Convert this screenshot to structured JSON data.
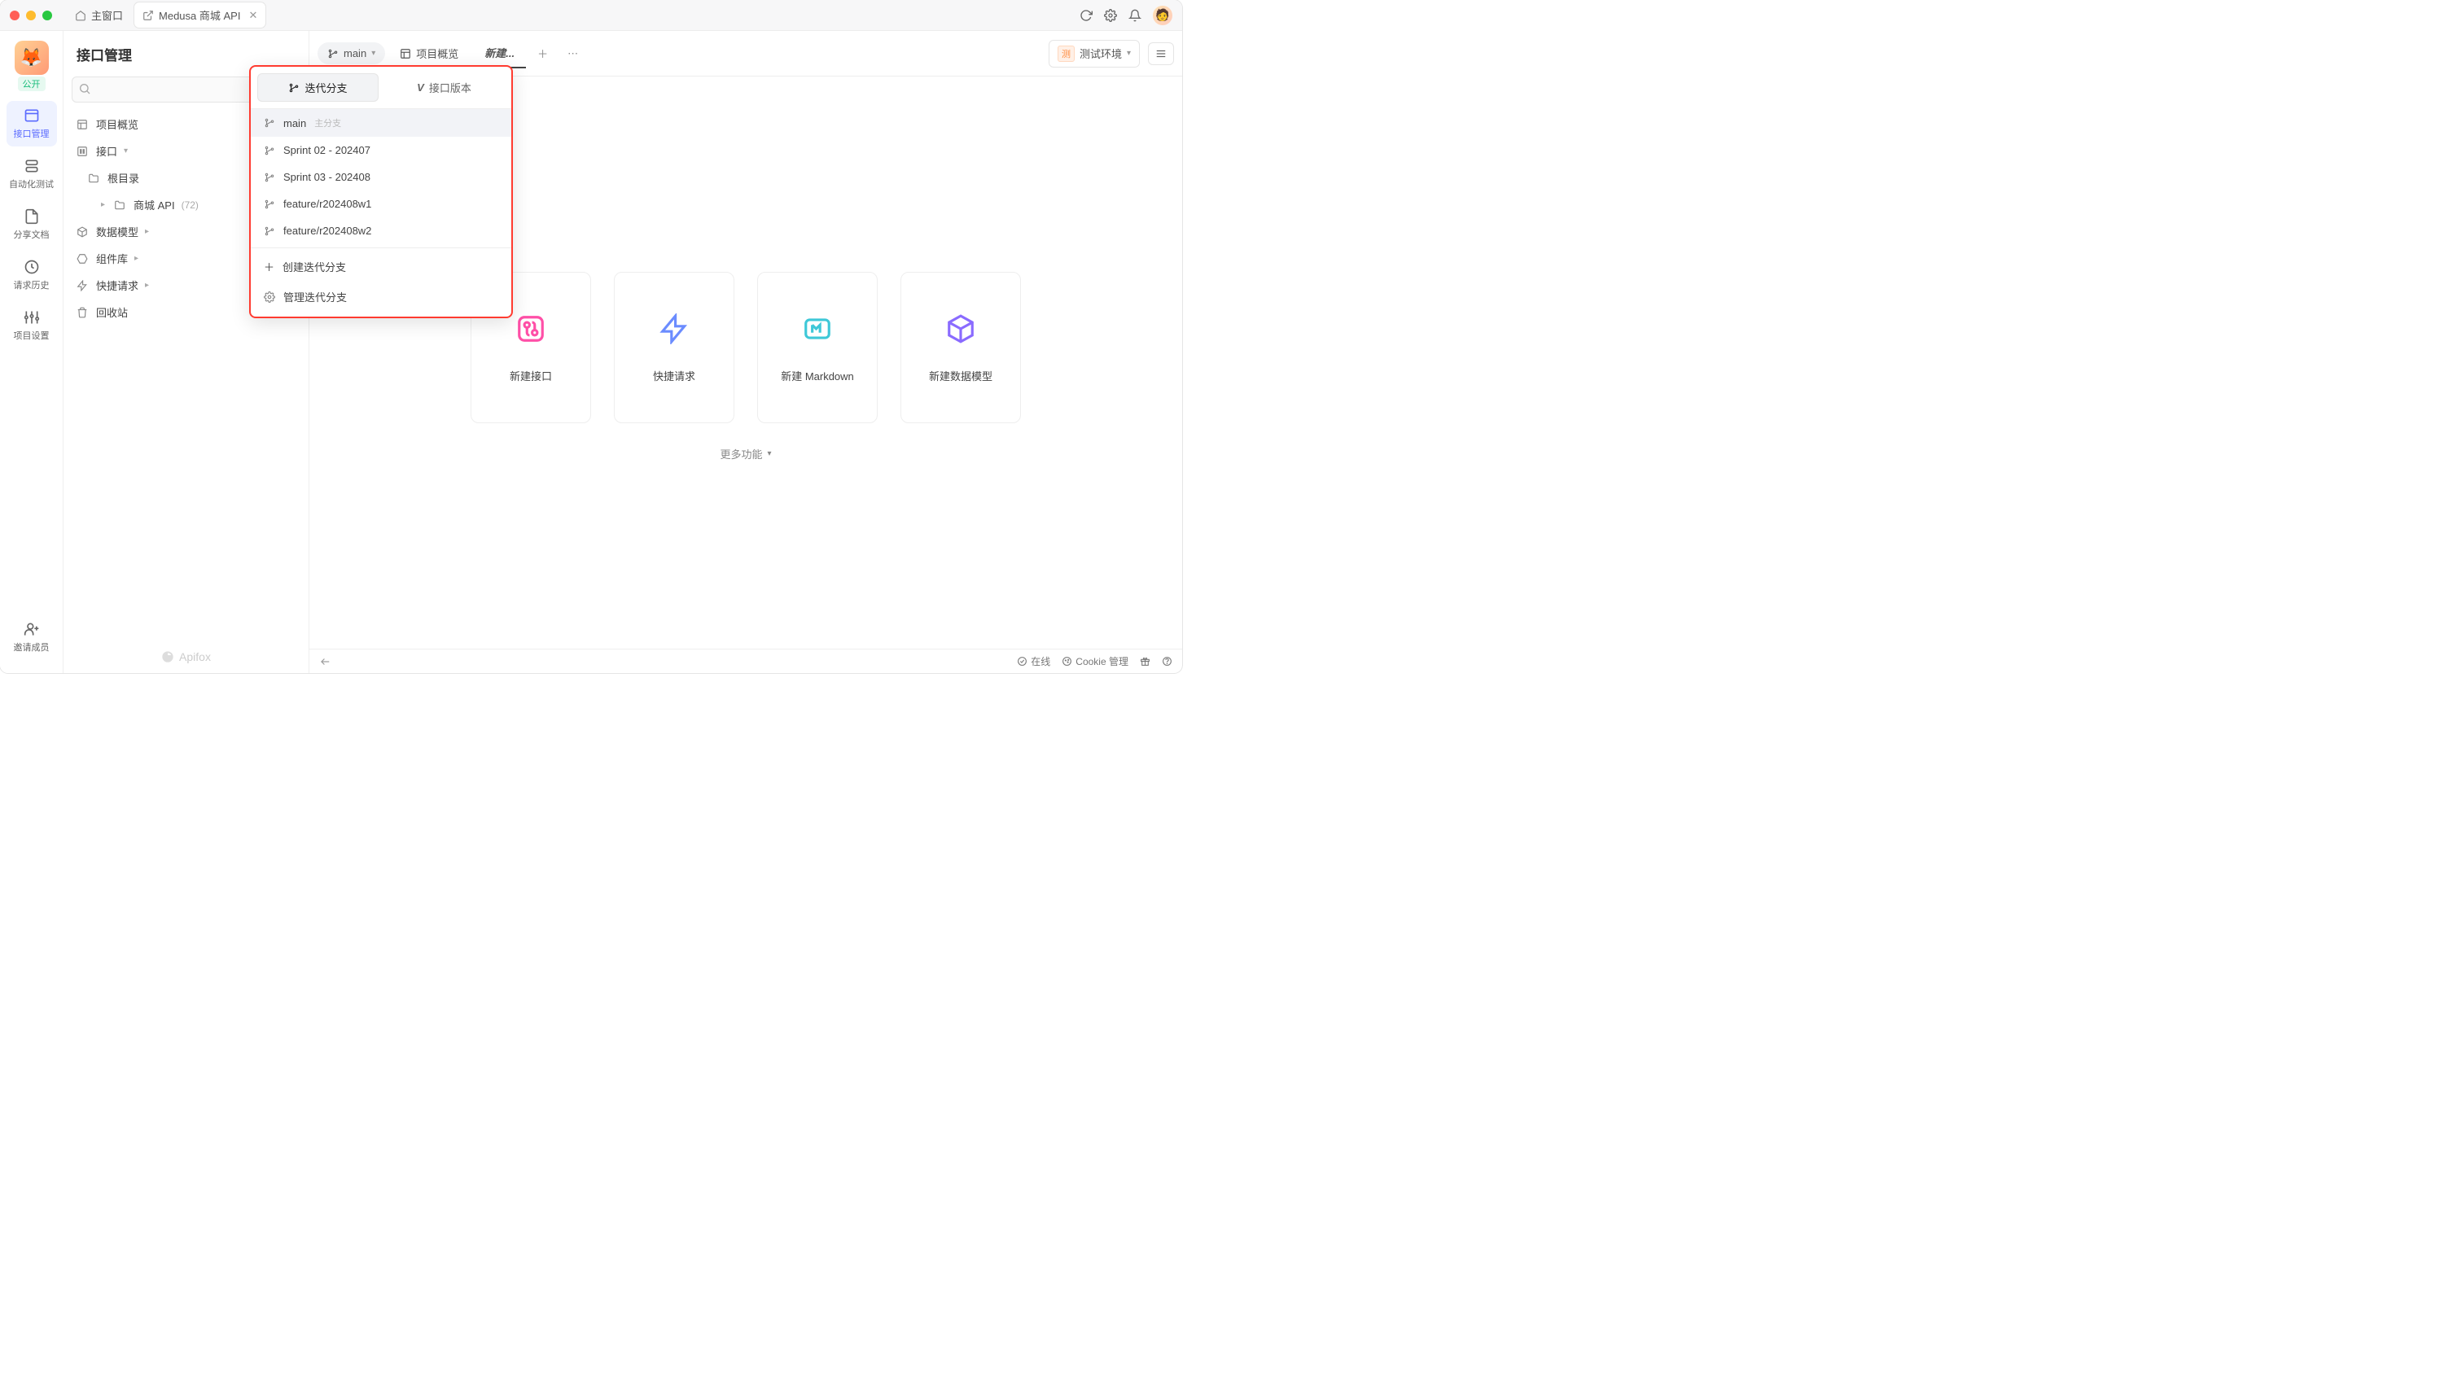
{
  "titlebar": {
    "main_window": "主窗口",
    "active_tab": "Medusa 商城 API"
  },
  "leftrail": {
    "project_badge": "公开",
    "items": [
      {
        "label": "接口管理",
        "active": true
      },
      {
        "label": "自动化测试"
      },
      {
        "label": "分享文档"
      },
      {
        "label": "请求历史"
      },
      {
        "label": "项目设置"
      }
    ],
    "invite": "邀请成员"
  },
  "sidebar": {
    "title": "接口管理",
    "search_placeholder": "",
    "items": {
      "overview": "项目概览",
      "api": "接口",
      "root": "根目录",
      "mall": "商城 API",
      "mall_count": "(72)",
      "model": "数据模型",
      "component": "组件库",
      "quick": "快捷请求",
      "trash": "回收站"
    },
    "brand": "Apifox"
  },
  "tabbar": {
    "branch": "main",
    "tabs": [
      {
        "label": "项目概览"
      },
      {
        "label": "新建...",
        "active": true
      }
    ],
    "env_label": "测试环境",
    "env_tag": "测"
  },
  "dropdown": {
    "tab_branch": "迭代分支",
    "tab_version": "接口版本",
    "branches": [
      {
        "name": "main",
        "tag": "主分支",
        "selected": true
      },
      {
        "name": "Sprint 02 - 202407"
      },
      {
        "name": "Sprint 03 - 202408"
      },
      {
        "name": "feature/r202408w1"
      },
      {
        "name": "feature/r202408w2"
      }
    ],
    "create": "创建迭代分支",
    "manage": "管理迭代分支"
  },
  "cards": [
    {
      "label": "新建接口",
      "color": "#ff4fa7"
    },
    {
      "label": "快捷请求",
      "color": "#6b8cff"
    },
    {
      "label": "新建 Markdown",
      "color": "#3ec8d8"
    },
    {
      "label": "新建数据模型",
      "color": "#8a6bff"
    }
  ],
  "more": "更多功能",
  "footer": {
    "online": "在线",
    "cookie": "Cookie 管理"
  }
}
